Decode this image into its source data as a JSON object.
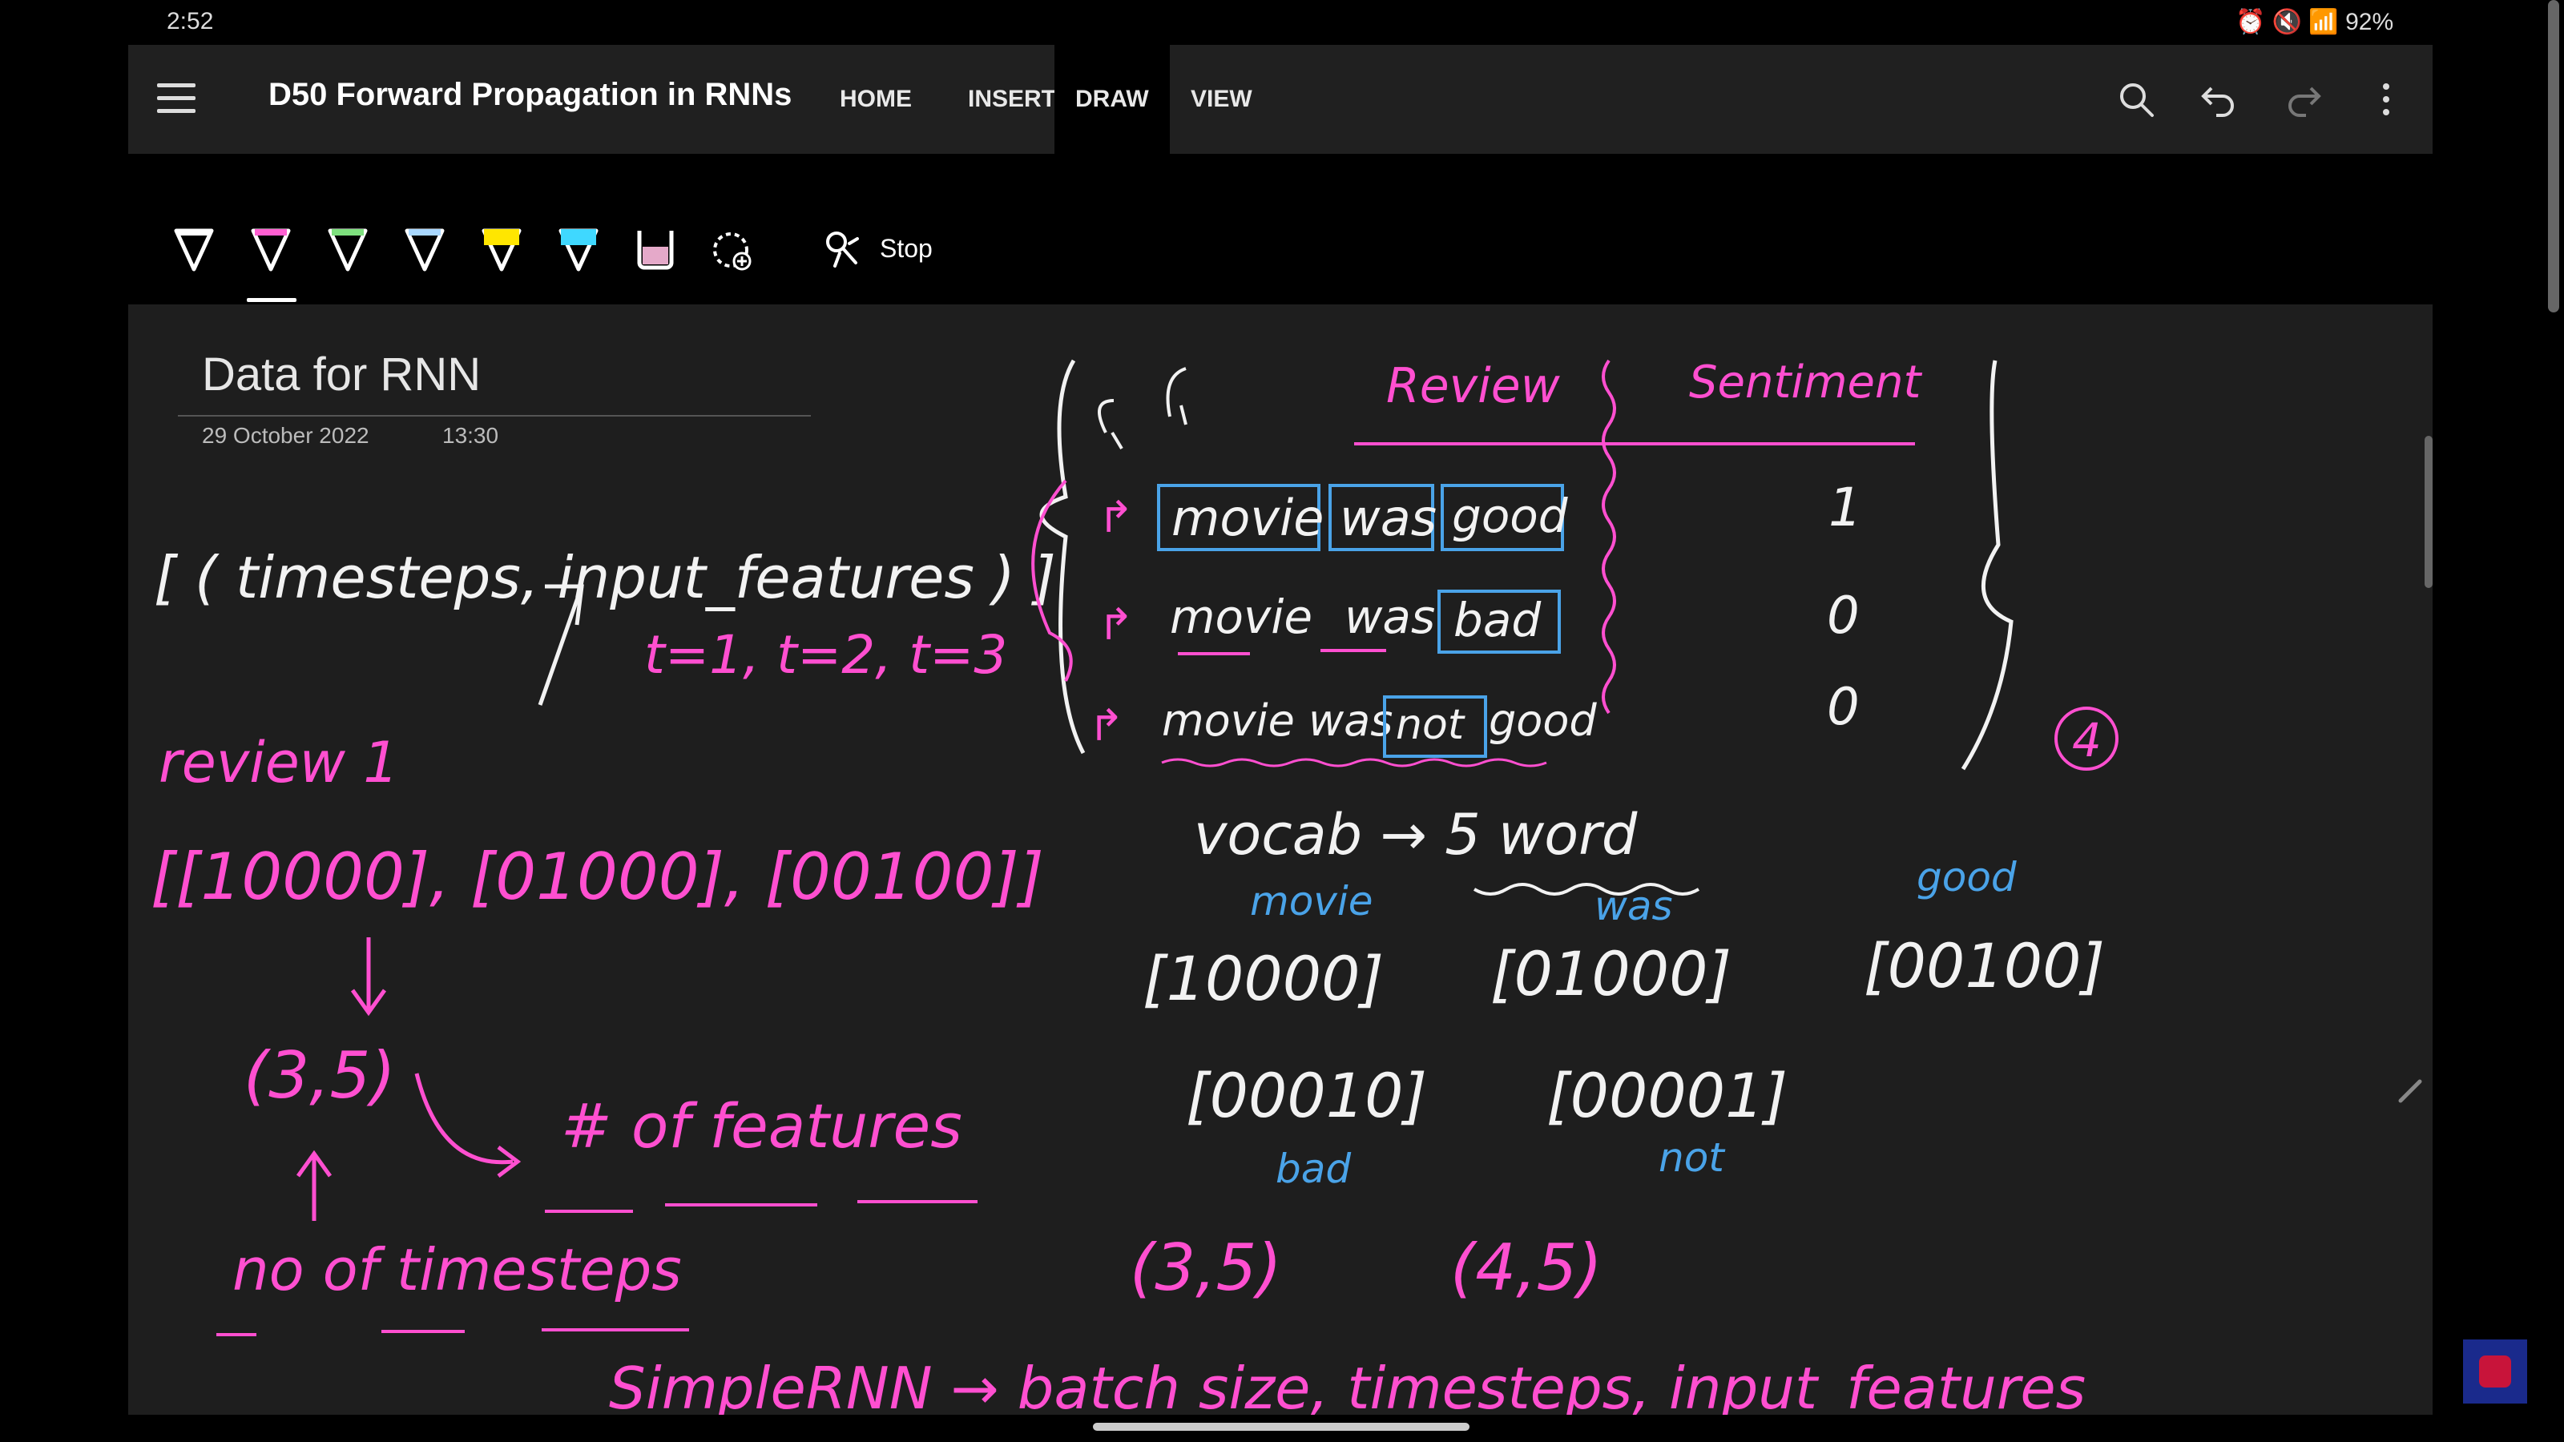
{
  "status_bar": {
    "time": "2:52",
    "battery": "92%"
  },
  "app": {
    "title": "D50 Forward Propagation in RNNs",
    "tabs": [
      "HOME",
      "INSERT",
      "DRAW",
      "VIEW"
    ],
    "active_tab": "DRAW"
  },
  "toolbar": {
    "pens": [
      {
        "name": "white-pen",
        "color": "#ffffff"
      },
      {
        "name": "pink-pen",
        "color": "#ff5fd2"
      },
      {
        "name": "green-pen",
        "color": "#7ee07e"
      },
      {
        "name": "light-blue-pen",
        "color": "#a9d8ff"
      },
      {
        "name": "yellow-highlighter",
        "color": "#ffe600"
      },
      {
        "name": "cyan-highlighter",
        "color": "#3fd8ff"
      },
      {
        "name": "eraser",
        "color": "#e5a9c9"
      }
    ],
    "stop_label": "Stop"
  },
  "page": {
    "title": "Data for RNN",
    "date": "29 October 2022",
    "time": "13:30"
  },
  "ink": {
    "colors": {
      "pink": "#ff4fd0",
      "white": "#f2f2f2",
      "blue": "#4aa3e8"
    },
    "shape_line": "[ ( timesteps, input_features ) ]",
    "t_line": "t=1, t=2, t=3",
    "review1": "review 1",
    "review_vectors": "[[10000], [01000], [00100]]",
    "shape_35": "(3,5)",
    "features_label": "# of features",
    "timesteps_label": "no of timesteps",
    "table_header_review": "Review",
    "table_header_sentiment": "Sentiment",
    "rows": [
      {
        "words": [
          "movie",
          "was",
          "good"
        ],
        "sentiment": "1"
      },
      {
        "words": [
          "movie",
          "was",
          "bad"
        ],
        "sentiment": "0"
      },
      {
        "words": [
          "movie was",
          "not",
          "good"
        ],
        "sentiment": "0"
      }
    ],
    "count_four": "4",
    "vocab_line": "vocab → 5 word",
    "word_movie": "movie",
    "word_was": "was",
    "word_good": "good",
    "vec_1": "[10000]",
    "vec_2": "[01000]",
    "vec_3": "[00100]",
    "vec_4": "[00010]",
    "vec_5": "[00001]",
    "word_bad": "bad",
    "word_not": "not",
    "shape_a": "(3,5)",
    "shape_b": "(4,5)",
    "bottom_line": "SimpleRNN → batch size, timesteps, input_features"
  }
}
